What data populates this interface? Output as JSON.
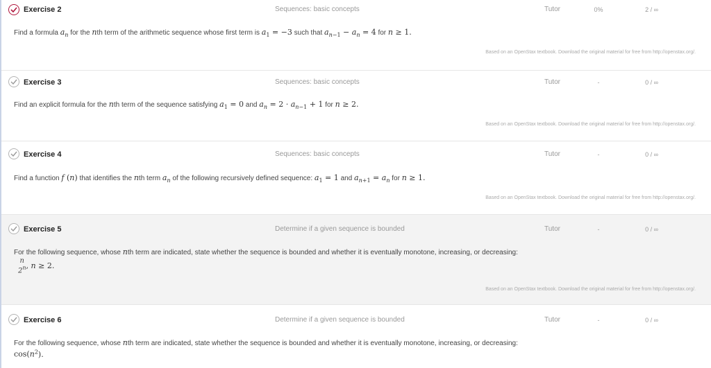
{
  "exercises": [
    {
      "title": "Exercise 2",
      "topic": "Sequences: basic concepts",
      "mode": "Tutor",
      "score": "0%",
      "attempts": "2 / ∞",
      "prompt_pre": "Find a formula",
      "prompt_t1": "for the",
      "prompt_t2": "th term of the arithmetic sequence whose first term is",
      "prompt_t3": "such that",
      "prompt_t4": "for",
      "attribution": "Based on an OpenStax textbook. Download the original material for free from http://openstax.org/."
    },
    {
      "title": "Exercise 3",
      "topic": "Sequences: basic concepts",
      "mode": "Tutor",
      "score": "-",
      "attempts": "0 / ∞",
      "prompt_pre": "Find an explicit formula for the",
      "prompt_t1": "th term of the sequence satisfying",
      "prompt_t2": "and",
      "prompt_t3": "for",
      "attribution": "Based on an OpenStax textbook. Download the original material for free from http://openstax.org/."
    },
    {
      "title": "Exercise 4",
      "topic": "Sequences: basic concepts",
      "mode": "Tutor",
      "score": "-",
      "attempts": "0 / ∞",
      "prompt_pre": "Find a function",
      "prompt_t1": "that identifies the",
      "prompt_t2": "th term",
      "prompt_t3": "of the following recursively defined sequence:",
      "prompt_t4": "and",
      "prompt_t5": "for",
      "attribution": "Based on an OpenStax textbook. Download the original material for free from http://openstax.org/."
    },
    {
      "title": "Exercise 5",
      "topic": "Determine if a given sequence is bounded",
      "mode": "Tutor",
      "score": "-",
      "attempts": "0 / ∞",
      "prompt_pre": "For the following sequence, whose",
      "prompt_t1": "th term are indicated, state whether the sequence is bounded and whether it is eventually monotone, increasing, or decreasing:",
      "attribution": "Based on an OpenStax textbook. Download the original material for free from http://openstax.org/."
    },
    {
      "title": "Exercise 6",
      "topic": "Determine if a given sequence is bounded",
      "mode": "Tutor",
      "score": "-",
      "attempts": "0 / ∞",
      "prompt_pre": "For the following sequence, whose",
      "prompt_t1": "th term are indicated, state whether the sequence is bounded and whether it is eventually monotone, increasing, or decreasing:"
    }
  ],
  "colors": {
    "accent": "#b0163c",
    "check_grey": "#b4b4b4",
    "row_shade": "#f3f3f3"
  }
}
